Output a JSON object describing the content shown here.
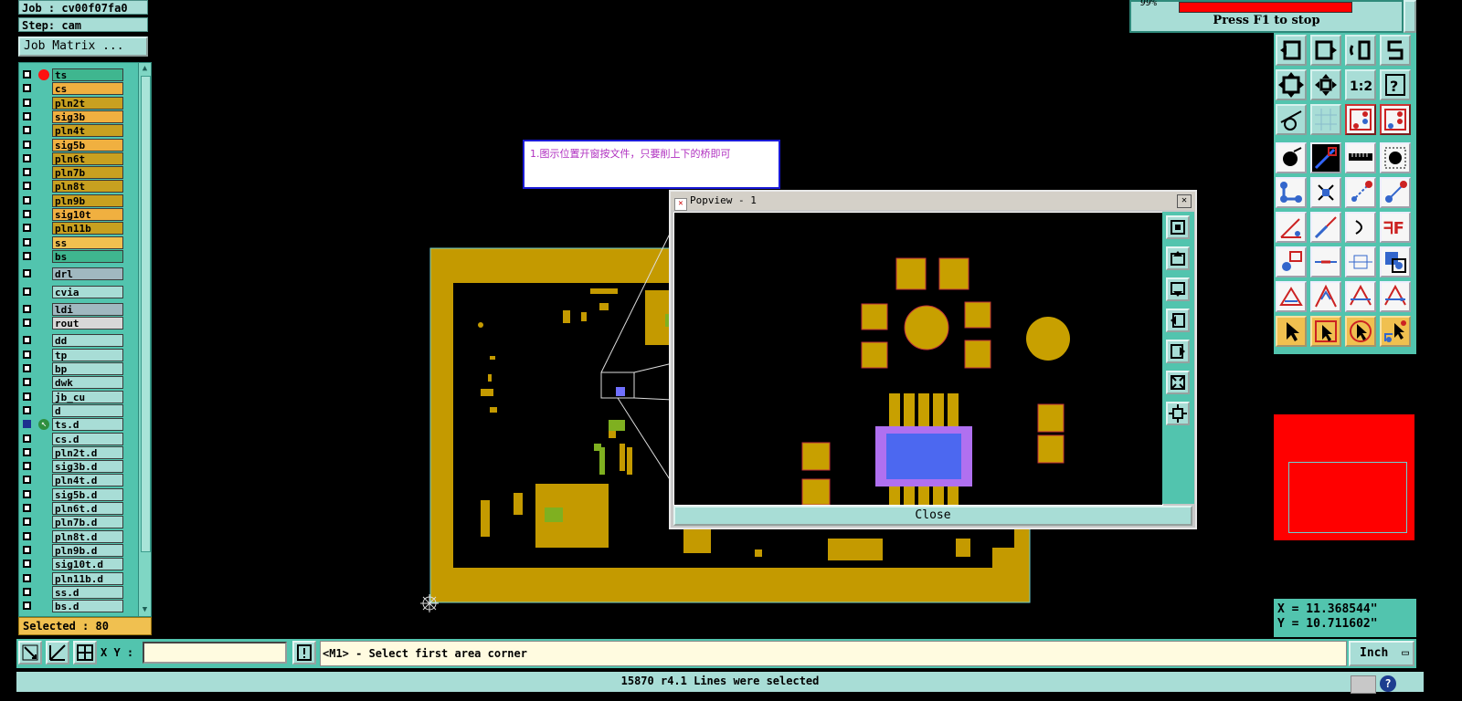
{
  "header": {
    "job": "Job : cv00f07fa0",
    "step": "Step: cam",
    "job_matrix": "Job Matrix ..."
  },
  "layers": [
    {
      "name": "ts",
      "color": "#3fb68f",
      "mark": "red"
    },
    {
      "name": "cs",
      "color": "#f0b040"
    },
    {
      "name": "pln2t",
      "color": "#c8a020"
    },
    {
      "name": "sig3b",
      "color": "#f0b040"
    },
    {
      "name": "pln4t",
      "color": "#c8a020"
    },
    {
      "name": "sig5b",
      "color": "#f0b040"
    },
    {
      "name": "pln6t",
      "color": "#c8a020"
    },
    {
      "name": "pln7b",
      "color": "#c8a020"
    },
    {
      "name": "pln8t",
      "color": "#c8a020"
    },
    {
      "name": "pln9b",
      "color": "#c8a020"
    },
    {
      "name": "sig10t",
      "color": "#f0b040"
    },
    {
      "name": "pln11b",
      "color": "#c8a020"
    },
    {
      "name": "ss",
      "color": "#f0c050"
    },
    {
      "name": "bs",
      "color": "#3fb68f"
    },
    {
      "name": "drl",
      "color": "#a0b8c0",
      "gap": true
    },
    {
      "name": "cvia",
      "color": "#a8ddd6",
      "gap": true
    },
    {
      "name": "ldi",
      "color": "#a0b8c0",
      "gap": true
    },
    {
      "name": "rout",
      "color": "#d8d8d8"
    },
    {
      "name": "dd",
      "color": "#a8ddd6",
      "gap": true
    },
    {
      "name": "tp",
      "color": "#a8ddd6"
    },
    {
      "name": "bp",
      "color": "#a8ddd6"
    },
    {
      "name": "dwk",
      "color": "#a8ddd6"
    },
    {
      "name": "jb_cu",
      "color": "#a8ddd6"
    },
    {
      "name": "d",
      "color": "#a8ddd6"
    },
    {
      "name": "ts.d",
      "color": "#a8ddd6",
      "mark": "arrow"
    },
    {
      "name": "cs.d",
      "color": "#a8ddd6"
    },
    {
      "name": "pln2t.d",
      "color": "#a8ddd6"
    },
    {
      "name": "sig3b.d",
      "color": "#a8ddd6"
    },
    {
      "name": "pln4t.d",
      "color": "#a8ddd6"
    },
    {
      "name": "sig5b.d",
      "color": "#a8ddd6"
    },
    {
      "name": "pln6t.d",
      "color": "#a8ddd6"
    },
    {
      "name": "pln7b.d",
      "color": "#a8ddd6"
    },
    {
      "name": "pln8t.d",
      "color": "#a8ddd6"
    },
    {
      "name": "pln9b.d",
      "color": "#a8ddd6"
    },
    {
      "name": "sig10t.d",
      "color": "#a8ddd6"
    },
    {
      "name": "pln11b.d",
      "color": "#a8ddd6"
    },
    {
      "name": "ss.d",
      "color": "#a8ddd6"
    },
    {
      "name": "bs.d",
      "color": "#a8ddd6"
    }
  ],
  "selected": "Selected : 80",
  "annotation": "1.图示位置开窗按文件，只要削上下的桥即可",
  "popview": {
    "title": "Popview - 1",
    "close_label": "Close"
  },
  "progress": {
    "percent_label": "99%",
    "text": "Press F1 to stop"
  },
  "coords": {
    "x": "X = 11.368544\"",
    "y": "Y = 10.711602\""
  },
  "bottom": {
    "xy_label": "X Y :",
    "xy_value": "",
    "prompt": "<M1> - Select first area corner",
    "units": "Inch",
    "status": "15870 r4.1 Lines were selected"
  },
  "colors": {
    "teal": "#52c4ae",
    "light_teal": "#a8ddd6",
    "gold": "#c49a00",
    "pad": "#c8a000"
  }
}
